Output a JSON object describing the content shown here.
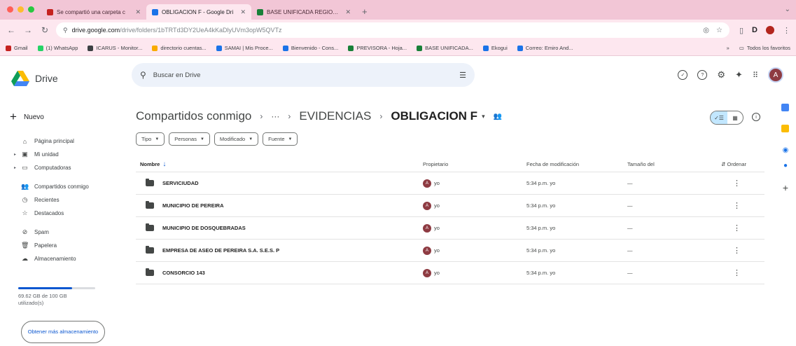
{
  "browser": {
    "tabs": [
      {
        "title": "Se compartió una carpeta c",
        "icon": "gmail-icon",
        "color": "#c5221f",
        "active": false
      },
      {
        "title": "OBLIGACION F - Google Dri",
        "icon": "drive-icon",
        "color": "#1a73e8",
        "active": true
      },
      {
        "title": "BASE UNIFICADA REGIONAL",
        "icon": "sheets-icon",
        "color": "#188038",
        "active": false
      }
    ],
    "url_host": "drive.google.com",
    "url_path": "/drive/folders/1bTRTd3DY2UeA4kKaDlyUVm3opW5QVTz",
    "bookmarks": [
      {
        "label": "Gmail",
        "color": "#c5221f"
      },
      {
        "label": "(1) WhatsApp",
        "color": "#25d366"
      },
      {
        "label": "ICARUS - Monitor...",
        "color": "#3c4043"
      },
      {
        "label": "directorio cuentas...",
        "color": "#f9ab00"
      },
      {
        "label": "SAMAI | Mis Proce...",
        "color": "#1a73e8"
      },
      {
        "label": "Bienvenido - Cons...",
        "color": "#1a73e8"
      },
      {
        "label": "PREVISORA - Hoja...",
        "color": "#188038"
      },
      {
        "label": "BASE UNIFICADA...",
        "color": "#188038"
      },
      {
        "label": "Ekogui",
        "color": "#1a73e8"
      },
      {
        "label": "Correo: Emiro And...",
        "color": "#1a73e8"
      }
    ],
    "bookmarks_more": "»",
    "all_bookmarks": "Todos los favoritos"
  },
  "drive": {
    "logo_text": "Drive",
    "search_placeholder": "Buscar en Drive",
    "avatar_letter": "A",
    "new_label": "Nuevo",
    "nav": [
      {
        "label": "Página principal",
        "icon": "home-icon",
        "glyph": "⌂",
        "expand": ""
      },
      {
        "label": "Mi unidad",
        "icon": "my-drive-icon",
        "glyph": "▣",
        "expand": "▸"
      },
      {
        "label": "Computadoras",
        "icon": "computers-icon",
        "glyph": "▭",
        "expand": "▸"
      },
      {
        "label": "Compartidos conmigo",
        "icon": "shared-icon",
        "glyph": "👥",
        "expand": "",
        "gap": true
      },
      {
        "label": "Recientes",
        "icon": "clock-icon",
        "glyph": "◷",
        "expand": ""
      },
      {
        "label": "Destacados",
        "icon": "star-icon",
        "glyph": "☆",
        "expand": ""
      },
      {
        "label": "Spam",
        "icon": "spam-icon",
        "glyph": "⊘",
        "expand": "",
        "gap": true
      },
      {
        "label": "Papelera",
        "icon": "trash-icon",
        "glyph": "🗑",
        "expand": ""
      },
      {
        "label": "Almacenamiento",
        "icon": "cloud-icon",
        "glyph": "☁",
        "expand": ""
      }
    ],
    "storage_text": "69.62 GB de 100 GB utilizado(s)",
    "storage_fraction": 0.6962,
    "get_more": "Obtener más almacenamiento",
    "breadcrumb": {
      "root": "Compartidos conmigo",
      "ellipsis": "···",
      "parent": "EVIDENCIAS",
      "current": "OBLIGACION F"
    },
    "filters": [
      "Tipo",
      "Personas",
      "Modificado",
      "Fuente"
    ],
    "columns": {
      "name": "Nombre",
      "owner": "Propietario",
      "modified": "Fecha de modificación",
      "size": "Tamaño del",
      "sort": "Ordenar"
    },
    "rows": [
      {
        "name": "SERVICIUDAD",
        "owner": "yo",
        "modified": "5:34 p.m. yo",
        "size": "—"
      },
      {
        "name": "MUNICIPIO DE PEREIRA",
        "owner": "yo",
        "modified": "5:34 p.m. yo",
        "size": "—"
      },
      {
        "name": "MUNICIPIO DE DOSQUEBRADAS",
        "owner": "yo",
        "modified": "5:34 p.m. yo",
        "size": "—"
      },
      {
        "name": "EMPRESA DE ASEO DE PEREIRA S.A. S.E.S. P",
        "owner": "yo",
        "modified": "5:34 p.m. yo",
        "size": "—"
      },
      {
        "name": "CONSORCIO 143",
        "owner": "yo",
        "modified": "5:34 p.m. yo",
        "size": "—"
      }
    ]
  }
}
